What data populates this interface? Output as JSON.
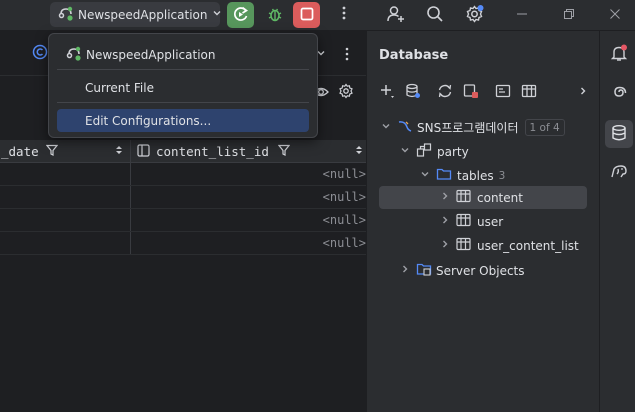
{
  "toolbar": {
    "run_config_label": "NewspeedApplication",
    "icons": [
      "run-config-icon",
      "chevron-down-icon",
      "rerun-icon",
      "debug-icon",
      "stop-icon",
      "more-icon",
      "add-user-icon",
      "search-icon",
      "settings-icon",
      "minimize-icon",
      "restore-icon",
      "close-icon"
    ]
  },
  "popup": {
    "items": [
      {
        "label": "NewspeedApplication",
        "icon": "run-config-icon"
      },
      {
        "label": "Current File"
      },
      {
        "label": "Edit Configurations...",
        "selected": true
      }
    ]
  },
  "grid": {
    "columns": [
      {
        "label": "_date"
      },
      {
        "label": "content_list_id"
      }
    ],
    "rows": [
      {
        "content_list_id": "<null>"
      },
      {
        "content_list_id": "<null>"
      },
      {
        "content_list_id": "<null>"
      },
      {
        "content_list_id": "<null>"
      }
    ]
  },
  "database": {
    "title": "Database",
    "tree": {
      "datasource": {
        "label": "SNS프로그램데이터",
        "pager": "1 of 4"
      },
      "schema": {
        "label": "party"
      },
      "tables": {
        "label": "tables",
        "count": "3"
      },
      "items": [
        {
          "label": "content",
          "selected": true
        },
        {
          "label": "user"
        },
        {
          "label": "user_content_list"
        }
      ],
      "server_objects": {
        "label": "Server Objects"
      }
    }
  },
  "colors": {
    "run_green": "#57965c",
    "stop_red": "#db5c5c",
    "popup_selected": "#2e436e",
    "tree_selected": "#43454a",
    "folder_blue": "#548af7",
    "notification_dot": "#e55765"
  }
}
